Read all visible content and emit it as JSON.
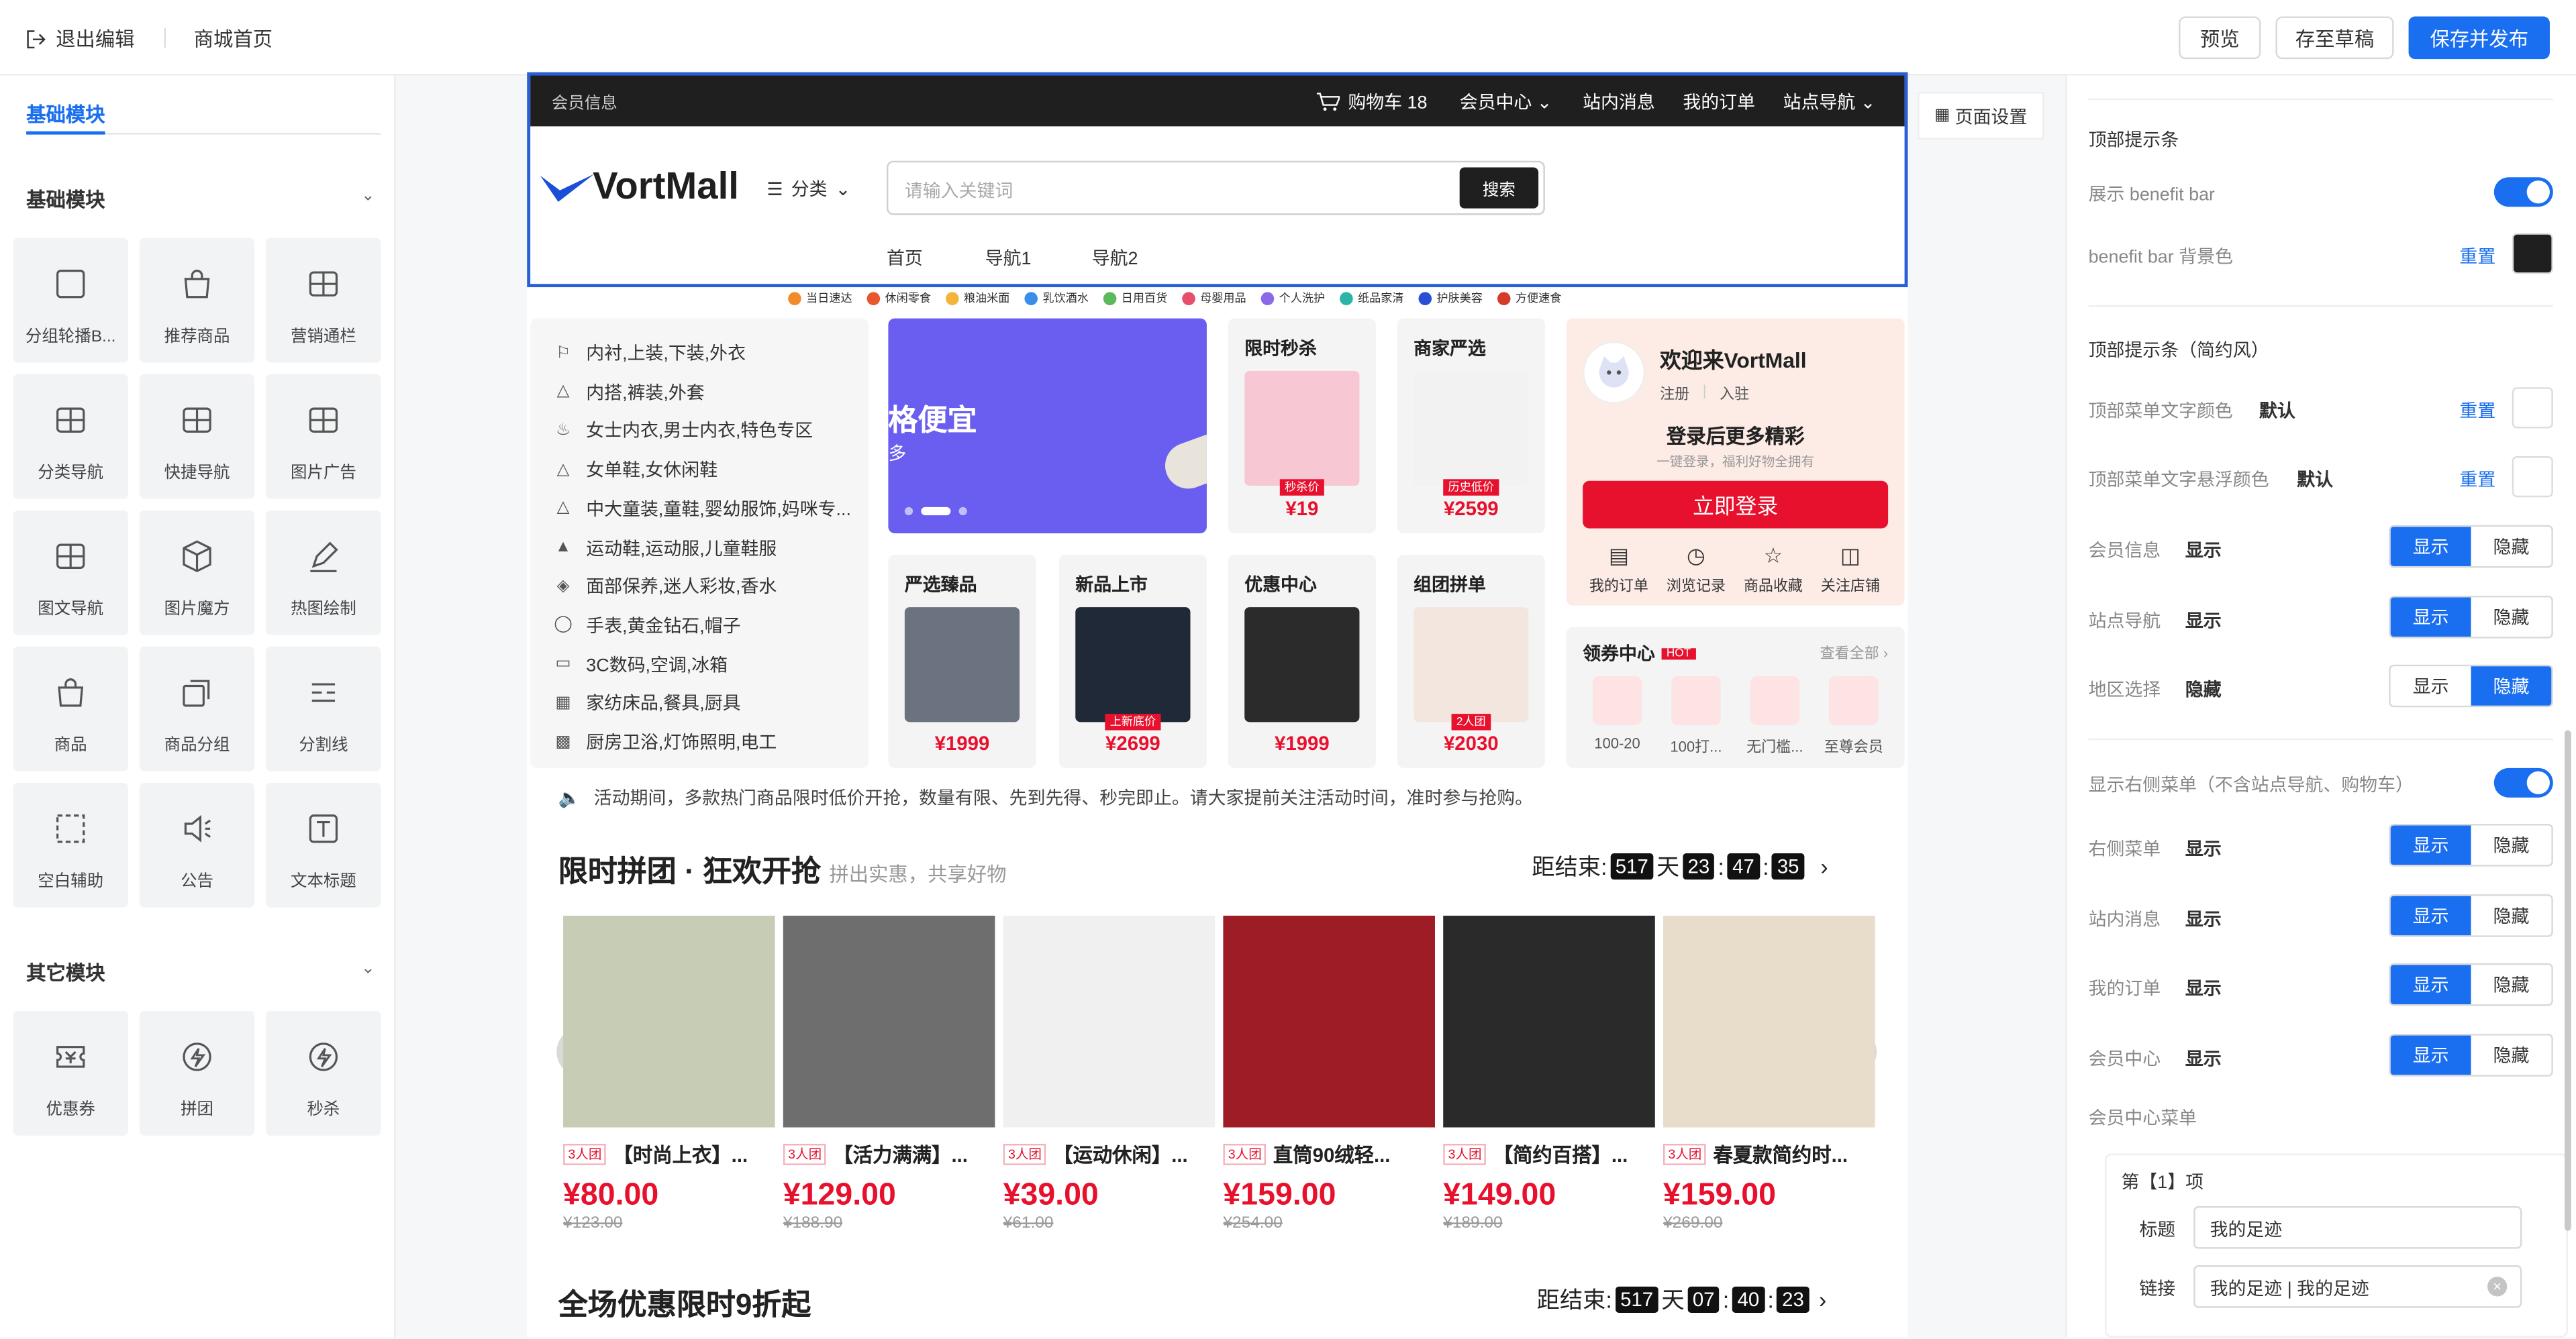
{
  "topbar": {
    "exit_label": "退出编辑",
    "page_name": "商城首页",
    "preview": "预览",
    "save_draft": "存至草稿",
    "save_publish": "保存并发布"
  },
  "left_panel": {
    "tab": "基础模块",
    "section_basic": "基础模块",
    "section_other": "其它模块",
    "basic_modules": [
      "分组轮播B...",
      "推荐商品",
      "营销通栏",
      "分类导航",
      "快捷导航",
      "图片广告",
      "图文导航",
      "图片魔方",
      "热图绘制",
      "商品",
      "商品分组",
      "分割线",
      "空白辅助",
      "公告",
      "文本标题"
    ],
    "other_modules": [
      "优惠券",
      "拼团",
      "秒杀"
    ]
  },
  "shop": {
    "member_info": "会员信息",
    "top_menu": {
      "cart": "购物车 18",
      "member_center": "会员中心",
      "messages": "站内消息",
      "orders": "我的订单",
      "site_nav": "站点导航"
    },
    "logo": "VortMall",
    "category_label": "分类",
    "search_placeholder": "请输入关键词",
    "search_button": "搜索",
    "nav": [
      "首页",
      "导航1",
      "导航2"
    ],
    "quick_cats": [
      "当日速达",
      "休闲零食",
      "粮油米面",
      "乳饮酒水",
      "日用百货",
      "母婴用品",
      "个人洗护",
      "纸品家清",
      "护肤美容",
      "方便速食"
    ],
    "category_menu": [
      "内衬,上装,下装,外衣",
      "内搭,裤装,外套",
      "女士内衣,男士内衣,特色专区",
      "女单鞋,女休闲鞋",
      "中大童装,童鞋,婴幼服饰,妈咪专...",
      "运动鞋,运动服,儿童鞋服",
      "面部保养,迷人彩妆,香水",
      "手表,黄金钻石,帽子",
      "3C数码,空调,冰箱",
      "家纺床品,餐具,厨具",
      "厨房卫浴,灯饰照明,电工"
    ],
    "banner_text": "格便宜",
    "banner_sub": "多",
    "cards": [
      {
        "title": "限时秒杀",
        "tag": "秒杀价",
        "price": "¥19"
      },
      {
        "title": "商家严选",
        "tag": "历史低价",
        "price": "¥2599"
      },
      {
        "title": "严选臻品",
        "tag": "",
        "price": "¥1999"
      },
      {
        "title": "新品上市",
        "tag": "上新底价",
        "price": "¥2699"
      },
      {
        "title": "优惠中心",
        "tag": "",
        "price": "¥1999"
      },
      {
        "title": "组团拼单",
        "tag": "2人团",
        "price": "¥2030"
      }
    ],
    "welcome": {
      "title": "欢迎来VortMall",
      "register": "注册",
      "join": "入驻",
      "headline": "登录后更多精彩",
      "sub": "一键登录，福利好物全拥有",
      "login": "立即登录",
      "links": [
        "我的订单",
        "浏览记录",
        "商品收藏",
        "关注店铺"
      ]
    },
    "coupons": {
      "title": "领券中心",
      "hot": "HOT",
      "view_all": "查看全部",
      "items": [
        "100-20",
        "100打...",
        "无门槛...",
        "至尊会员"
      ]
    },
    "notice": "活动期间，多款热门商品限时低价开抢，数量有限、先到先得、秒完即止。请大家提前关注活动时间，准时参与抢购。",
    "group_buy": {
      "title": "限时拼团 · 狂欢开抢",
      "subtitle": "拼出实惠，共享好物",
      "timer_label": "距结束:",
      "days": "517",
      "day_unit": "天",
      "hh": "23",
      "mm": "47",
      "ss": "35",
      "products": [
        {
          "badge": "3人团",
          "name": "【时尚上衣】...",
          "price": "¥80.00",
          "orig": "¥123.00"
        },
        {
          "badge": "3人团",
          "name": "【活力满满】...",
          "price": "¥129.00",
          "orig": "¥188.90"
        },
        {
          "badge": "3人团",
          "name": "【运动休闲】...",
          "price": "¥39.00",
          "orig": "¥61.00"
        },
        {
          "badge": "3人团",
          "name": "直筒90绒轻...",
          "price": "¥159.00",
          "orig": "¥254.00"
        },
        {
          "badge": "3人团",
          "name": "【简约百搭】...",
          "price": "¥149.00",
          "orig": "¥189.00"
        },
        {
          "badge": "3人团",
          "name": "春夏款简约时...",
          "price": "¥159.00",
          "orig": "¥269.00"
        }
      ]
    },
    "discount": {
      "title": "全场优惠限时9折起",
      "timer_label": "距结束:",
      "days": "517",
      "day_unit": "天",
      "hh": "07",
      "mm": "40",
      "ss": "23"
    }
  },
  "page_settings": "页面设置",
  "right_panel": {
    "sec1": "顶部提示条",
    "show_benefit": "展示 benefit bar",
    "benefit_bg": "benefit bar 背景色",
    "reset": "重置",
    "sec2": "顶部提示条（简约风）",
    "menu_text_color": "顶部菜单文字颜色",
    "menu_hover_color": "顶部菜单文字悬浮颜色",
    "default": "默认",
    "show": "显示",
    "hide": "隐藏",
    "member_info": "会员信息",
    "site_nav": "站点导航",
    "region": "地区选择",
    "show_right_menu": "显示右侧菜单（不含站点导航、购物车）",
    "right_menu": "右侧菜单",
    "messages": "站内消息",
    "orders": "我的订单",
    "member_center": "会员中心",
    "member_menu": "会员中心菜单",
    "item_label": "第【1】项",
    "title_label": "标题",
    "title_value": "我的足迹",
    "link_label": "链接",
    "link_value": "我的足迹 | 我的足迹",
    "colors": {
      "accent": "#1a6ff0",
      "benefit_bg": "#1f1f1f",
      "price_red": "#e8112d"
    }
  }
}
